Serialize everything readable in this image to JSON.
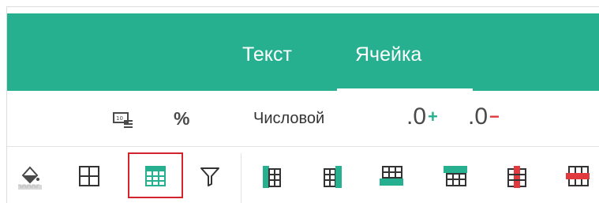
{
  "tabs": [
    {
      "label": "Текст",
      "active": false
    },
    {
      "label": "Ячейка",
      "active": true
    }
  ],
  "colors": {
    "accent": "#26b08f",
    "highlight_border": "#d3242e",
    "increase_sign": "#26b08f",
    "decrease_sign": "#e0393e"
  },
  "format_bar": {
    "number_format_icon": "number-format-icon",
    "percent_label": "%",
    "number_format_label": "Числовой",
    "increase_decimal": {
      "digit": ".0",
      "sign": "+"
    },
    "decrease_decimal": {
      "digit": ".0",
      "sign": "−"
    }
  },
  "cell_toolbar": {
    "icons": [
      "fill-color-icon",
      "borders-icon",
      "format-as-table-icon",
      "filter-icon",
      "insert-column-left-icon",
      "insert-column-right-icon",
      "insert-row-below-icon",
      "insert-row-above-icon",
      "delete-column-icon",
      "delete-row-icon"
    ],
    "selected": "format-as-table-icon"
  }
}
